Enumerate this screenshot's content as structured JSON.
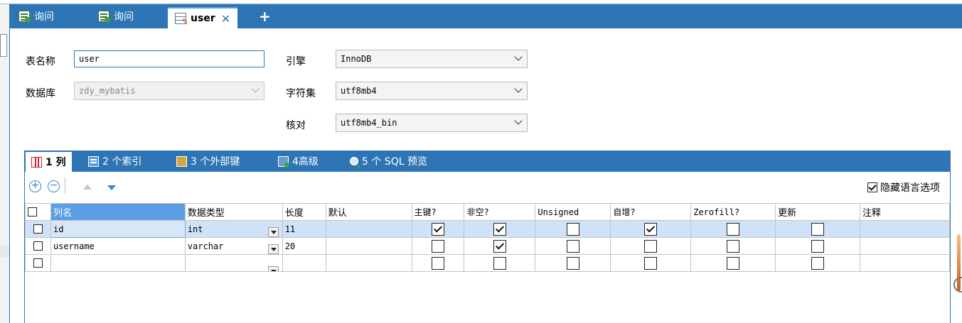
{
  "tabs": [
    {
      "label": "询问",
      "icon": "query-icon"
    },
    {
      "label": "询问",
      "icon": "query-icon"
    },
    {
      "label": "user",
      "icon": "table-design-icon",
      "active": true,
      "close": "✕"
    }
  ],
  "add_tab": "+",
  "form": {
    "table_name_label": "表名称",
    "table_name_value": "user",
    "database_label": "数据库",
    "database_value": "zdy_mybatis",
    "engine_label": "引擎",
    "engine_value": "InnoDB",
    "charset_label": "字符集",
    "charset_value": "utf8mb4",
    "collation_label": "核对",
    "collation_value": "utf8mb4_bin"
  },
  "inner_tabs": [
    {
      "label": "1 列",
      "icon": "columns-icon",
      "active": true
    },
    {
      "label": "2 个索引",
      "icon": "index-icon"
    },
    {
      "label": "3 个外部键",
      "icon": "foreign-key-icon"
    },
    {
      "label": "4高级",
      "icon": "advanced-icon"
    },
    {
      "label": "5 个 SQL 预览",
      "icon": "sql-preview-icon"
    }
  ],
  "toolbar": {
    "add": "+",
    "remove": "−",
    "hide_language_label": "隐藏语言选项",
    "hide_language_checked": true
  },
  "grid": {
    "headers": [
      "列名",
      "数据类型",
      "长度",
      "默认",
      "主键?",
      "非空?",
      "Unsigned",
      "自增?",
      "Zerofill?",
      "更新",
      "注释"
    ],
    "rows": [
      {
        "name": "id",
        "type": "int",
        "length": "11",
        "default": "",
        "pk": true,
        "notnull": true,
        "unsigned": false,
        "autoinc": true,
        "zerofill": false,
        "update": false,
        "comment": "",
        "selected": true
      },
      {
        "name": "username",
        "type": "varchar",
        "length": "20",
        "default": "",
        "pk": false,
        "notnull": true,
        "unsigned": false,
        "autoinc": false,
        "zerofill": false,
        "update": false,
        "comment": ""
      },
      {
        "name": "",
        "type": "",
        "length": "",
        "default": "",
        "pk": false,
        "notnull": false,
        "unsigned": false,
        "autoinc": false,
        "zerofill": false,
        "update": false,
        "comment": ""
      }
    ]
  },
  "colors": {
    "accent": "#2e75b6",
    "selected_header": "#5b9ee6",
    "selected_row": "#cfe2f7"
  }
}
